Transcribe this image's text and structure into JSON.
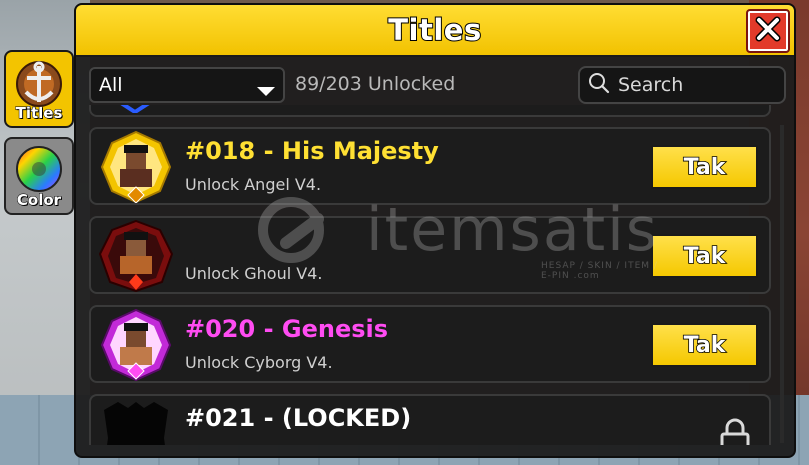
{
  "window": {
    "title": "Titles",
    "close_icon": "close-x-icon"
  },
  "side_tabs": [
    {
      "label": "Titles",
      "icon": "anchor-emblem-icon",
      "active": true
    },
    {
      "label": "Color",
      "icon": "color-wheel-icon",
      "active": false
    }
  ],
  "toolbar": {
    "filter_value": "All",
    "unlock_count": "89/203 Unlocked",
    "search_placeholder": "Search"
  },
  "titles": [
    {
      "title": "#018 - His Majesty",
      "subtitle": "Unlock Angel V4.",
      "button": "Tak",
      "title_color": "#ffe033",
      "locked": false
    },
    {
      "title": "",
      "subtitle": "Unlock Ghoul V4.",
      "button": "Tak",
      "title_color": "#ffffff",
      "locked": false
    },
    {
      "title": "#020 - Genesis",
      "subtitle": "Unlock Cyborg V4.",
      "button": "Tak",
      "title_color": "#ff4cf2",
      "locked": false
    },
    {
      "title": "#021 - (LOCKED)",
      "subtitle": "",
      "button": "",
      "title_color": "#ffffff",
      "locked": true
    }
  ],
  "watermark": {
    "text": "itemsatis",
    "sub": "HESAP / SKIN / ITEM / E-PIN .com"
  },
  "colors": {
    "accent": "#f5c800",
    "panel": "#1c1c1c",
    "close": "#e23a2a"
  }
}
